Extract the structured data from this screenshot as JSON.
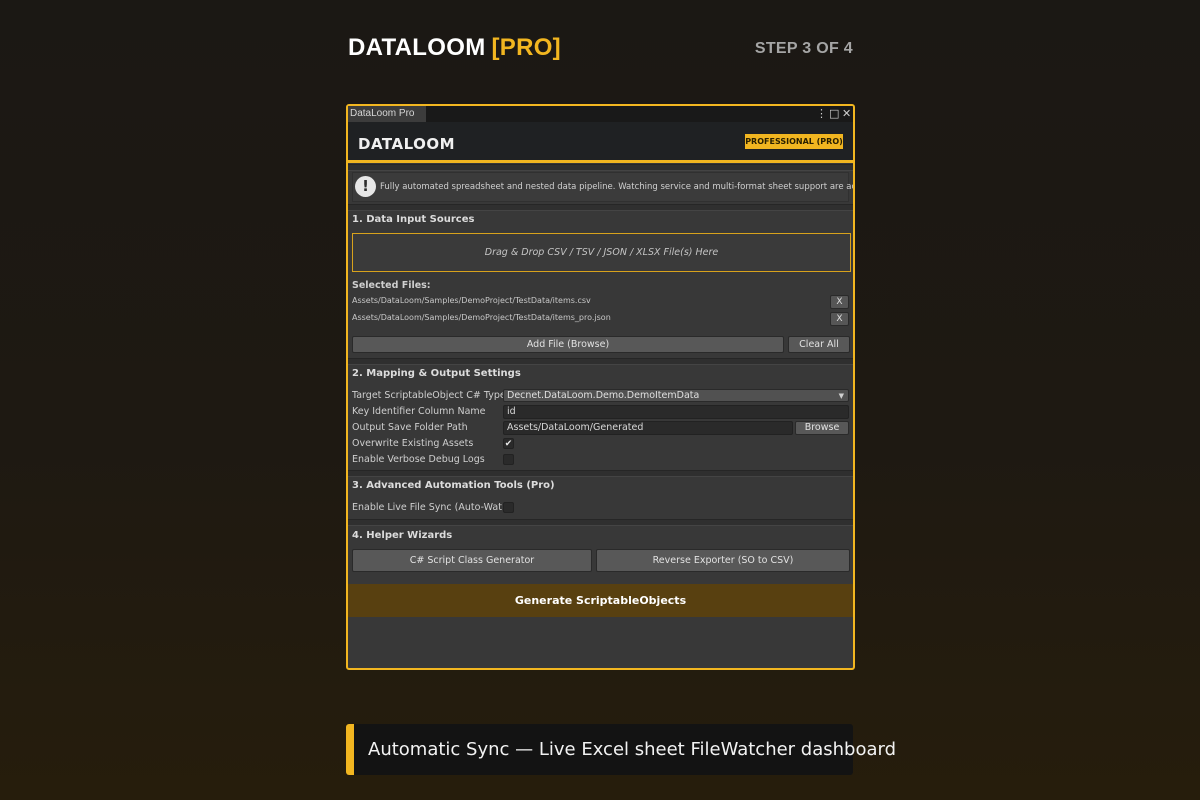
{
  "header": {
    "brand": "DATALOOM",
    "brand_suffix": "[PRO]",
    "step": "STEP 3 OF 4"
  },
  "window": {
    "tab_label": "DataLoom Pro",
    "icons": [
      "kebab-menu-icon",
      "maximize-icon",
      "close-icon"
    ]
  },
  "app": {
    "title": "DATALOOM",
    "badge": "PROFESSIONAL (PRO)",
    "info_text": "Fully automated spreadsheet and nested data pipeline. Watching service and multi-format sheet support are active."
  },
  "section1": {
    "title": "1. Data Input Sources",
    "dropzone": "Drag & Drop CSV / TSV / JSON / XLSX File(s) Here",
    "selected_label": "Selected Files:",
    "files": [
      "Assets/DataLoom/Samples/DemoProject/TestData/items.csv",
      "Assets/DataLoom/Samples/DemoProject/TestData/items_pro.json"
    ],
    "remove_label": "X",
    "add_file": "Add File (Browse)",
    "clear_all": "Clear All"
  },
  "section2": {
    "title": "2. Mapping & Output Settings",
    "type_label": "Target ScriptableObject C# Type",
    "type_value": "Decnet.DataLoom.Demo.DemoItemData",
    "key_label": "Key Identifier Column Name",
    "key_value": "id",
    "path_label": "Output Save Folder Path",
    "path_value": "Assets/DataLoom/Generated",
    "browse": "Browse",
    "overwrite_label": "Overwrite Existing Assets",
    "overwrite_checked": true,
    "verbose_label": "Enable Verbose Debug Logs",
    "verbose_checked": false
  },
  "section3": {
    "title": "3. Advanced Automation Tools (Pro)",
    "live_sync_label": "Enable Live File Sync (Auto-Watc",
    "live_sync_checked": false
  },
  "section4": {
    "title": "4. Helper Wizards",
    "script_gen": "C# Script Class Generator",
    "reverse_export": "Reverse Exporter (SO to CSV)"
  },
  "generate": "Generate ScriptableObjects",
  "caption": "Automatic Sync — Live Excel sheet FileWatcher dashboard",
  "colors": {
    "accent": "#f2b620",
    "generate_bg": "#584010",
    "panel": "#383838"
  }
}
